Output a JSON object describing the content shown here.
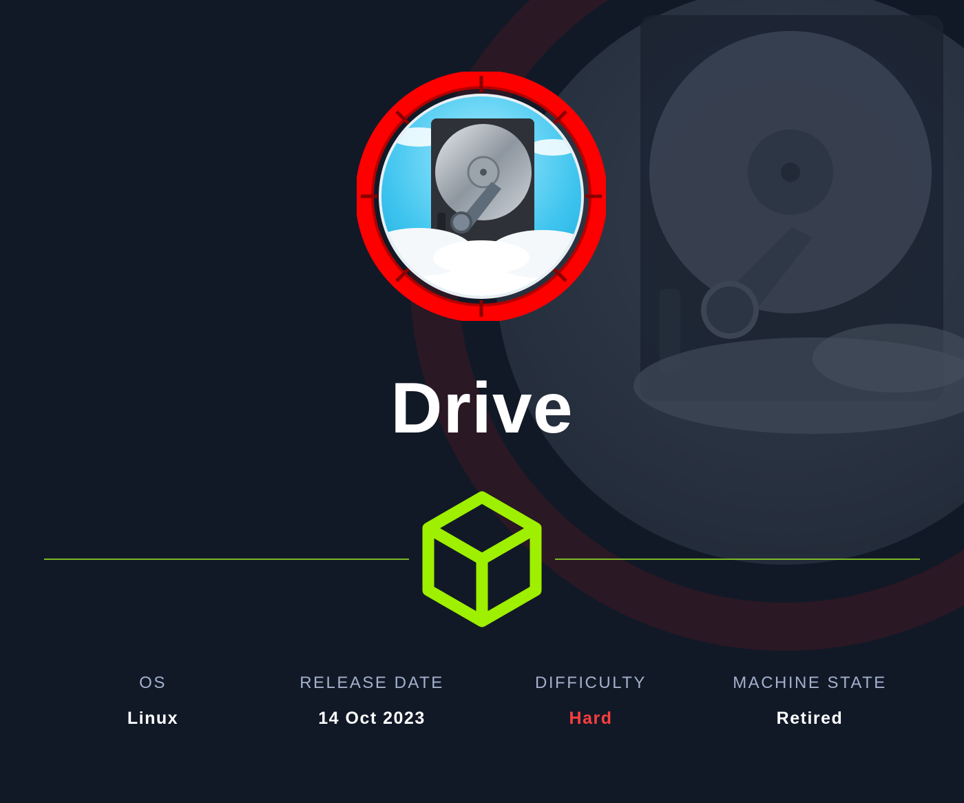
{
  "machine": {
    "name": "Drive"
  },
  "colors": {
    "background": "#111927",
    "ring": "#ff0000",
    "accent_green": "#9fef00",
    "label": "#a4b1cd",
    "difficulty_hard": "#ff3e3e"
  },
  "icons": {
    "avatar": "hard-drive-in-clouds-icon",
    "divider": "cube-icon"
  },
  "info": {
    "os": {
      "label": "OS",
      "value": "Linux"
    },
    "release_date": {
      "label": "RELEASE DATE",
      "value": "14 Oct 2023"
    },
    "difficulty": {
      "label": "DIFFICULTY",
      "value": "Hard"
    },
    "machine_state": {
      "label": "MACHINE STATE",
      "value": "Retired"
    }
  }
}
